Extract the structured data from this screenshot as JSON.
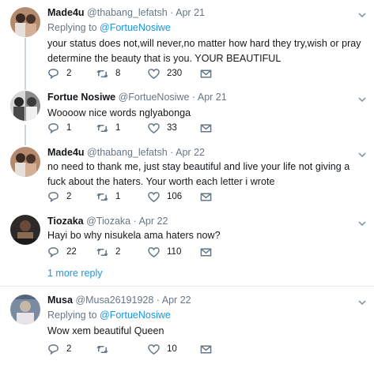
{
  "tweets": [
    {
      "name": "Made4u",
      "handle": "@thabang_lefatsh",
      "dot": "·",
      "date": "Apr 21",
      "replying_prefix": "Replying to",
      "replying_to": "@FortueNosiwe",
      "text": "your status does not,will never,no matter how hard they try,wish or pray determine the beauty that is you. YOUR BEAUTIFUL",
      "replies": "2",
      "retweets": "8",
      "likes": "230"
    },
    {
      "name": "Fortue Nosiwe",
      "handle": "@FortueNosiwe",
      "dot": "·",
      "date": "Apr 21",
      "text": "Woooow nice words nglyabonga",
      "replies": "1",
      "retweets": "1",
      "likes": "33"
    },
    {
      "name": "Made4u",
      "handle": "@thabang_lefatsh",
      "dot": "·",
      "date": "Apr 22",
      "text": "no need to thank me, just stay beautiful and live your life not giving a fuck about the haters. Your worth each letter i wrote",
      "replies": "2",
      "retweets": "1",
      "likes": "106"
    },
    {
      "name": "Tiozaka",
      "handle": "@Tiozaka",
      "dot": "·",
      "date": "Apr 22",
      "text": "Hayi bo why nisukela ama haters now?",
      "replies": "22",
      "retweets": "2",
      "likes": "110"
    },
    {
      "name": "Musa",
      "handle": "@Musa26191928",
      "dot": "·",
      "date": "Apr 22",
      "replying_prefix": "Replying to",
      "replying_to": "@FortueNosiwe",
      "text": "Wow xem beautiful Queen",
      "replies": "2",
      "retweets": "",
      "likes": "10"
    }
  ],
  "more_replies": "1 more reply",
  "icons": {
    "reply": "reply-icon",
    "retweet": "retweet-icon",
    "like": "heart-icon",
    "dm": "envelope-icon",
    "caret": "chevron-down-icon"
  },
  "colors": {
    "link": "#1b95e0",
    "muted": "#657786",
    "text": "#14171a",
    "divider": "#e6ecf0",
    "thread": "#ccd6dd"
  }
}
